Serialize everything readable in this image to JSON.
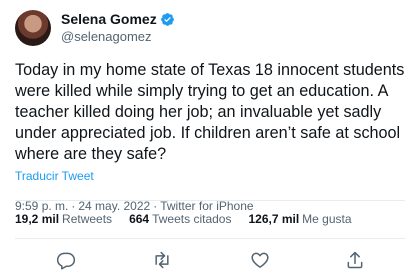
{
  "author": {
    "display_name": "Selena Gomez",
    "handle": "@selenagomez"
  },
  "icons": {
    "verified": "verified-badge-icon",
    "reply": "reply-icon",
    "retweet": "retweet-icon",
    "like": "heart-icon",
    "share": "share-icon"
  },
  "colors": {
    "accent": "#1d9bf0",
    "secondary_text": "#536471",
    "primary_text": "#0f1419"
  },
  "tweet": {
    "text": "Today in my home state of Texas 18 innocent students were killed while simply trying to get an education. A teacher killed doing her job; an invaluable yet sadly under appreciated job. If children aren’t safe at school where are they safe?",
    "translate_label": "Traducir Tweet",
    "time": "9:59 p. m.",
    "date": "24 may. 2022",
    "source": "Twitter for iPhone",
    "separator": "·"
  },
  "stats": {
    "retweets_count": "19,2 mil",
    "retweets_label": "Retweets",
    "quotes_count": "664",
    "quotes_label": "Tweets citados",
    "likes_count": "126,7 mil",
    "likes_label": "Me gusta"
  }
}
